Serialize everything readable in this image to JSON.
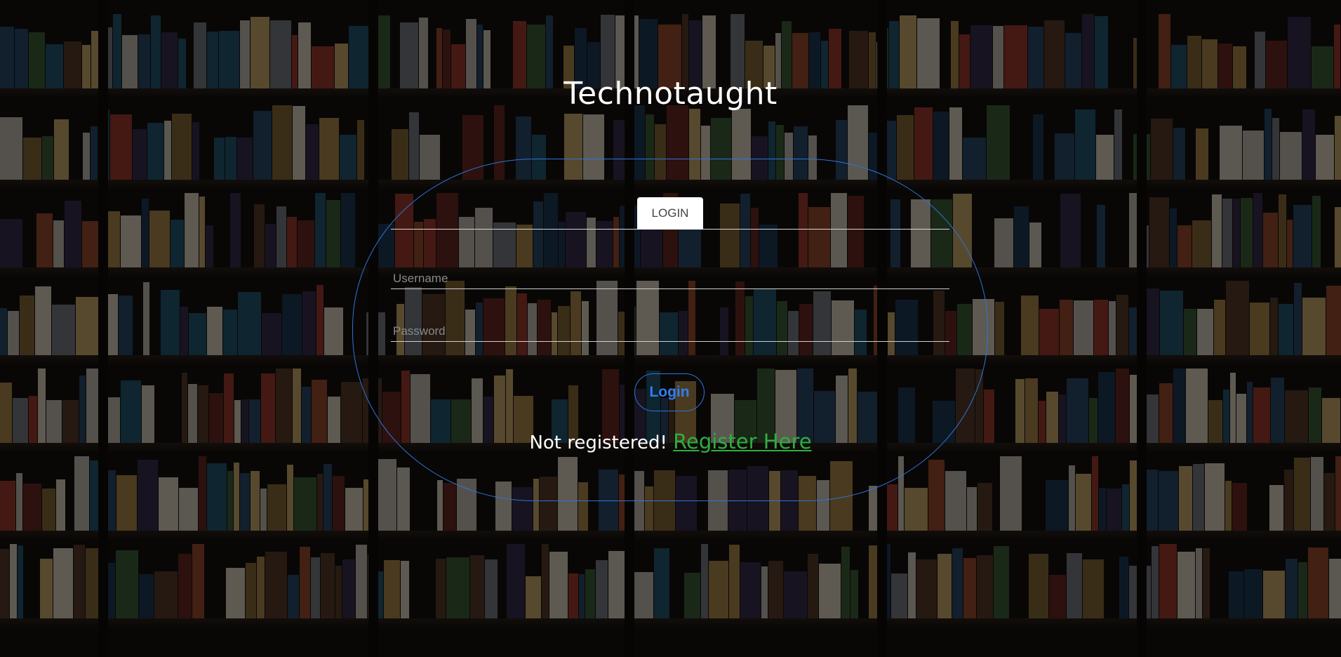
{
  "app": {
    "title": "Technotaught"
  },
  "login_form": {
    "tab_label": "LOGIN",
    "username_placeholder": "Username",
    "password_placeholder": "Password",
    "submit_label": "Login",
    "register_prompt": "Not registered!",
    "register_link_label": "Register Here"
  },
  "colors": {
    "accent_blue": "#2f73d8",
    "link_green": "#2fae3f",
    "title_white": "#ffffff"
  }
}
